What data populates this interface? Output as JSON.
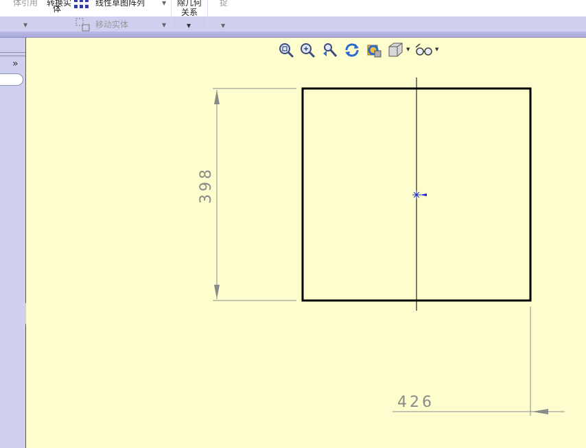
{
  "ribbon": {
    "items": {
      "entity_ref": "体引用",
      "convert_entity_top": "转换实",
      "convert_entity_bottom": "体",
      "linear_pattern": "线性草图阵列",
      "move_entity": "移动实体",
      "relations_top": "除几何",
      "relations_bottom": "关系",
      "extra": "捉"
    }
  },
  "view_toolbar": {
    "icons": [
      "zoom-to-fit-icon",
      "zoom-to-area-icon",
      "previous-view-icon",
      "rotate-view-icon",
      "section-view-icon",
      "view-orientation-icon",
      "hide-show-items-icon"
    ]
  },
  "left_panel": {
    "expand_glyph": "»"
  },
  "sketch": {
    "dimensions": {
      "height": "398",
      "width": "426"
    }
  },
  "colors": {
    "canvas_bg": "#fdfdcd",
    "panel_bg": "#cfcff0",
    "dimension": "#8a8a8a",
    "sketch_line": "#000000",
    "origin": "#1a2acc"
  }
}
